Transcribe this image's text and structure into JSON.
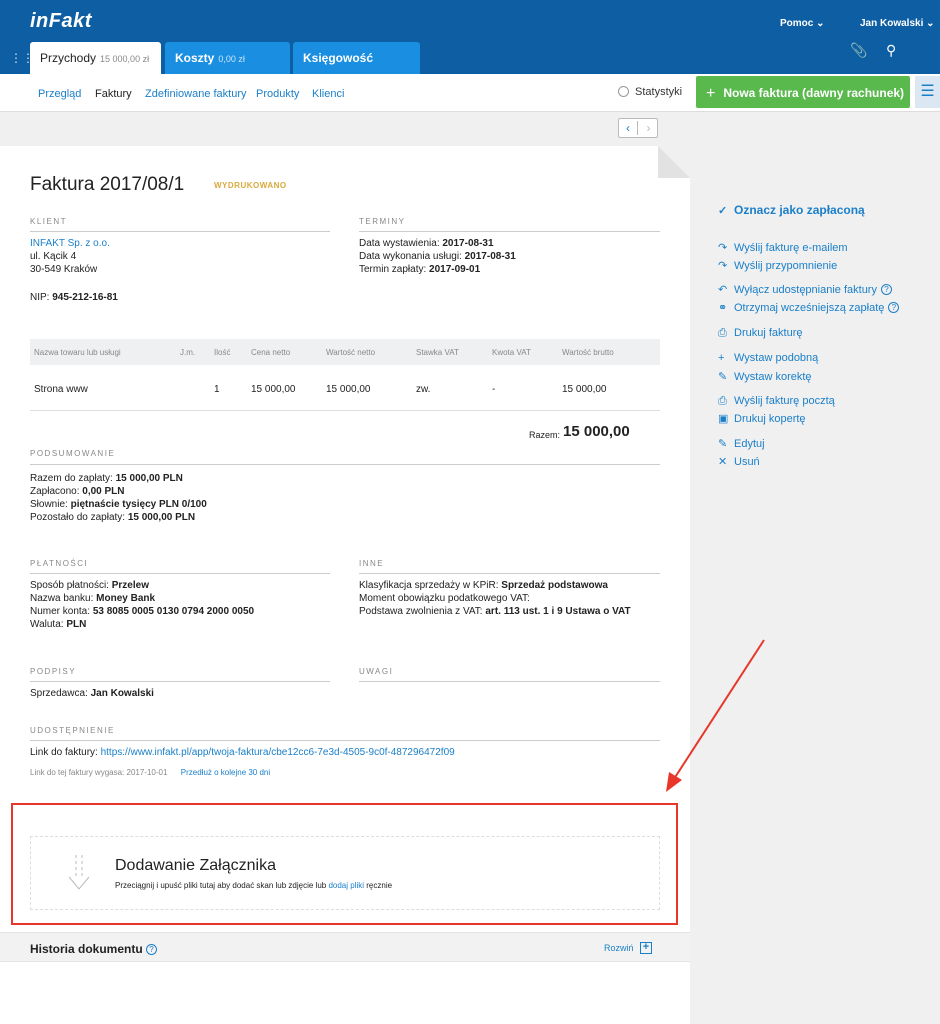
{
  "header": {
    "logo": "inFakt",
    "help": "Pomoc",
    "user": "Jan Kowalski",
    "tabs": [
      {
        "label": "Przychody",
        "amount": "15 000,00 zł"
      },
      {
        "label": "Koszty",
        "amount": "0,00 zł"
      },
      {
        "label": "Księgowość",
        "amount": ""
      }
    ]
  },
  "subnav": {
    "items": [
      "Przegląd",
      "Faktury",
      "Zdefiniowane faktury",
      "Produkty",
      "Klienci"
    ],
    "stats": "Statystyki",
    "new_invoice": "Nowa faktura (dawny rachunek)"
  },
  "invoice": {
    "title": "Faktura 2017/08/1",
    "status": "WYDRUKOWANO",
    "client": {
      "label": "KLIENT",
      "name": "INFAKT Sp. z o.o.",
      "street": "ul. Kącik 4",
      "city": "30-549 Kraków",
      "nip_label": "NIP:",
      "nip": "945-212-16-81"
    },
    "terms": {
      "label": "TERMINY",
      "issue_label": "Data wystawienia:",
      "issue": "2017-08-31",
      "service_label": "Data wykonania usługi:",
      "service": "2017-08-31",
      "due_label": "Termin zapłaty:",
      "due": "2017-09-01"
    },
    "table": {
      "headers": [
        "Nazwa towaru lub usługi",
        "J.m.",
        "Ilość",
        "Cena netto",
        "Wartość netto",
        "Stawka VAT",
        "Kwota VAT",
        "Wartość brutto"
      ],
      "rows": [
        [
          "Strona www",
          "",
          "1",
          "15 000,00",
          "15 000,00",
          "zw.",
          "-",
          "15 000,00"
        ]
      ],
      "total_label": "Razem:",
      "total": "15 000,00"
    },
    "summary": {
      "label": "PODSUMOWANIE",
      "to_pay_label": "Razem do zapłaty:",
      "to_pay": "15 000,00 PLN",
      "paid_label": "Zapłacono:",
      "paid": "0,00 PLN",
      "words_label": "Słownie:",
      "words": "piętnaście tysięcy PLN 0/100",
      "remaining_label": "Pozostało do zapłaty:",
      "remaining": "15 000,00 PLN"
    },
    "payments": {
      "label": "PŁATNOŚCI",
      "method_label": "Sposób płatności:",
      "method": "Przelew",
      "bank_label": "Nazwa banku:",
      "bank": "Money Bank",
      "account_label": "Numer konta:",
      "account": "53 8085 0005 0130 0794 2000 0050",
      "currency_label": "Waluta:",
      "currency": "PLN"
    },
    "other": {
      "label": "INNE",
      "kpir_label": "Klasyfikacja sprzedaży w KPiR:",
      "kpir": "Sprzedaż podstawowa",
      "vat_moment": "Moment obowiązku podatkowego VAT:",
      "exemption_label": "Podstawa zwolnienia z VAT:",
      "exemption": "art. 113 ust. 1 i 9 Ustawa o VAT"
    },
    "signatures": {
      "label": "PODPISY",
      "seller_label": "Sprzedawca:",
      "seller": "Jan Kowalski"
    },
    "notes": {
      "label": "UWAGI"
    },
    "sharing": {
      "label": "UDOSTĘPNIENIE",
      "link_label": "Link do faktury:",
      "link": "https://www.infakt.pl/app/twoja-faktura/cbe12cc6-7e3d-4505-9c0f-487296472f09",
      "expires": "Link do tej faktury wygasa: 2017-10-01",
      "extend": "Przedłuż o kolejne 30 dni"
    },
    "attachment": {
      "title": "Dodawanie Załącznika",
      "text_before": "Przeciągnij i upuść pliki tutaj aby dodać skan lub zdjęcie lub ",
      "link": "dodaj pliki",
      "text_after": " ręcznie"
    },
    "history": {
      "title": "Historia dokumentu",
      "expand": "Rozwiń"
    }
  },
  "actions": [
    {
      "icon": "check-icon",
      "label": "Oznacz jako zapłaconą"
    },
    {
      "icon": "forward-icon",
      "label": "Wyślij fakturę e-mailem"
    },
    {
      "icon": "forward-icon",
      "label": "Wyślij przypomnienie"
    },
    {
      "icon": "unshare-icon",
      "label": "Wyłącz udostępnianie faktury"
    },
    {
      "icon": "payment-icon",
      "label": "Otrzymaj wcześniejszą zapłatę"
    },
    {
      "icon": "print-icon",
      "label": "Drukuj fakturę"
    },
    {
      "icon": "plus-icon",
      "label": "Wystaw podobną"
    },
    {
      "icon": "pencil-icon",
      "label": "Wystaw korektę"
    },
    {
      "icon": "print-icon",
      "label": "Wyślij fakturę pocztą"
    },
    {
      "icon": "envelope-icon",
      "label": "Drukuj kopertę"
    },
    {
      "icon": "pencil-icon",
      "label": "Edytuj"
    },
    {
      "icon": "x-icon",
      "label": "Usuń"
    }
  ]
}
